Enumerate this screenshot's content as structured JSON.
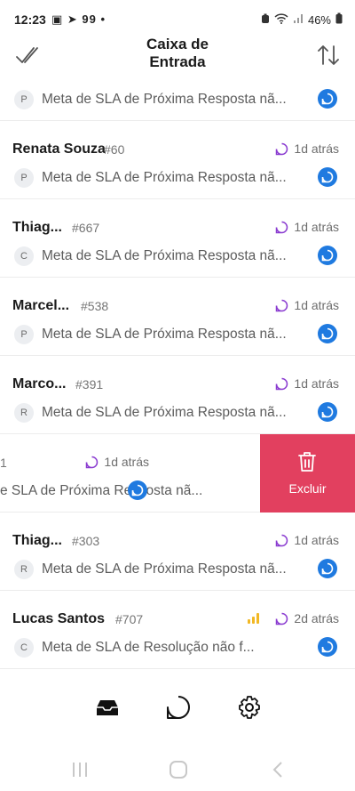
{
  "status_bar": {
    "time": "12:23",
    "left_icons": "▣ ➤ 99 •",
    "battery": "46%"
  },
  "header": {
    "title_line1": "Caixa de",
    "title_line2": "Entrada"
  },
  "conversations": [
    {
      "name": "",
      "id": "",
      "time": "",
      "avatar": "P",
      "message": "Meta de SLA de Próxima Resposta nã..."
    },
    {
      "name": "Renata Souza",
      "id": "#60",
      "time": "1d atrás",
      "avatar": "P",
      "message": "Meta de SLA de Próxima Resposta nã..."
    },
    {
      "name": "Thiag...",
      "id": "#667",
      "time": "1d atrás",
      "avatar": "C",
      "message": "Meta de SLA de Próxima Resposta nã..."
    },
    {
      "name": "Marcel...",
      "id": "#538",
      "time": "1d atrás",
      "avatar": "P",
      "message": "Meta de SLA de Próxima Resposta nã..."
    },
    {
      "name": "Marco...",
      "id": "#391",
      "time": "1d atrás",
      "avatar": "R",
      "message": "Meta de SLA de Próxima Resposta nã..."
    },
    {
      "name": "",
      "id": "1",
      "time": "1d atrás",
      "avatar": "",
      "message": "e SLA de Próxima Resposta nã..."
    },
    {
      "name": "Thiag...",
      "id": "#303",
      "time": "1d atrás",
      "avatar": "R",
      "message": "Meta de SLA de Próxima Resposta nã..."
    },
    {
      "name": "Lucas Santos",
      "id": "#707",
      "time": "2d atrás",
      "avatar": "C",
      "message": "Meta de SLA de Resolução não f..."
    }
  ],
  "swipe_action": {
    "label": "Excluir",
    "color": "#e2405f"
  },
  "colors": {
    "accent": "#1f7ae0",
    "status_icon": "#8a3bd0",
    "priority": "#f2b824"
  },
  "tabs": [
    "inbox-icon",
    "conversations-icon",
    "settings-icon"
  ]
}
